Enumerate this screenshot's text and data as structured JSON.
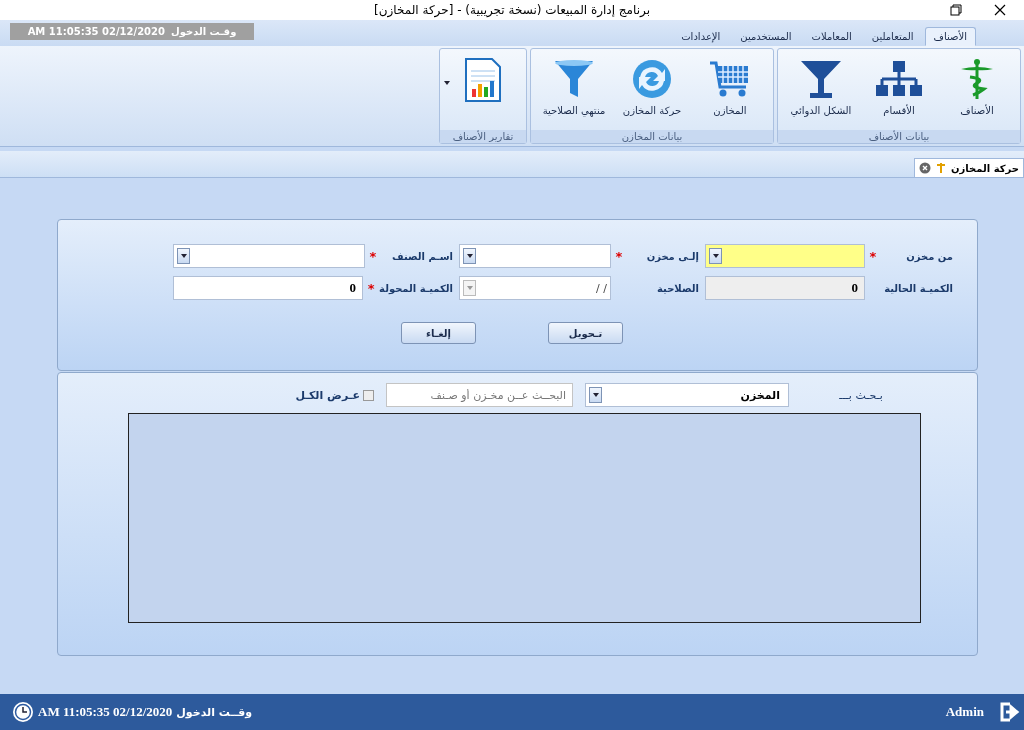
{
  "window": {
    "title": "برنامج إدارة المبيعات (نسخة تجريبية) - [حركة المخازن]"
  },
  "menu_tabs": [
    {
      "label": "الأصناف",
      "selected": true
    },
    {
      "label": "المتعاملين",
      "selected": false
    },
    {
      "label": "المعاملات",
      "selected": false
    },
    {
      "label": "المستخدمين",
      "selected": false
    },
    {
      "label": "الإعدادات",
      "selected": false
    }
  ],
  "login_box": {
    "label": "وقـت الدخول",
    "value": "AM 11:05:35 02/12/2020"
  },
  "ribbon_groups": [
    {
      "title": "بيانات الأصناف",
      "buttons": [
        {
          "label": "الأصناف",
          "kind": "caduceus"
        },
        {
          "label": "الأقسام",
          "kind": "hierarchy"
        },
        {
          "label": "الشكل الدوائي",
          "kind": "goblet"
        }
      ]
    },
    {
      "title": "بيانات المخازن",
      "buttons": [
        {
          "label": "المخازن",
          "kind": "cart"
        },
        {
          "label": "حركة المخازن",
          "kind": "refresh"
        },
        {
          "label": "منتهي الصلاحية",
          "kind": "funnel"
        }
      ]
    },
    {
      "title": "تقارير الأصناف",
      "buttons": [
        {
          "kind": "report",
          "dropdown": true
        }
      ]
    }
  ],
  "document_tab": {
    "label": "حركة المخازن"
  },
  "form_rows": [
    [
      {
        "label": "من مخزن",
        "required_mark": "*",
        "kind": "combo",
        "focused": true
      },
      {
        "label": "إلـى مخزن",
        "required_mark": "*",
        "kind": "combo",
        "focused": false
      },
      {
        "label": "اسـم الصنف",
        "required_mark": "*",
        "kind": "combo",
        "focused": false
      }
    ],
    [
      {
        "label": "الكميـة الحالية",
        "kind": "readonly",
        "value": "0"
      },
      {
        "label": "الصلاحية",
        "kind": "date",
        "value": "/ /"
      },
      {
        "label": "الكميـة المحولة",
        "required_mark": "*",
        "kind": "number",
        "value": "0"
      }
    ]
  ],
  "form_buttons": [
    "تـحويل",
    "إلغـاء"
  ],
  "search": {
    "label": "بـحـث بـــ",
    "field": "المخزن",
    "placeholder": "البحــث عــن مخـزن أو صـنف",
    "show_all": {
      "label": "عـرض الكـل",
      "checked": false
    }
  },
  "status_bar": {
    "user": "Admin",
    "login_time": "وقــت الدخول",
    "time_value": "AM 11:05:35 02/12/2020"
  }
}
